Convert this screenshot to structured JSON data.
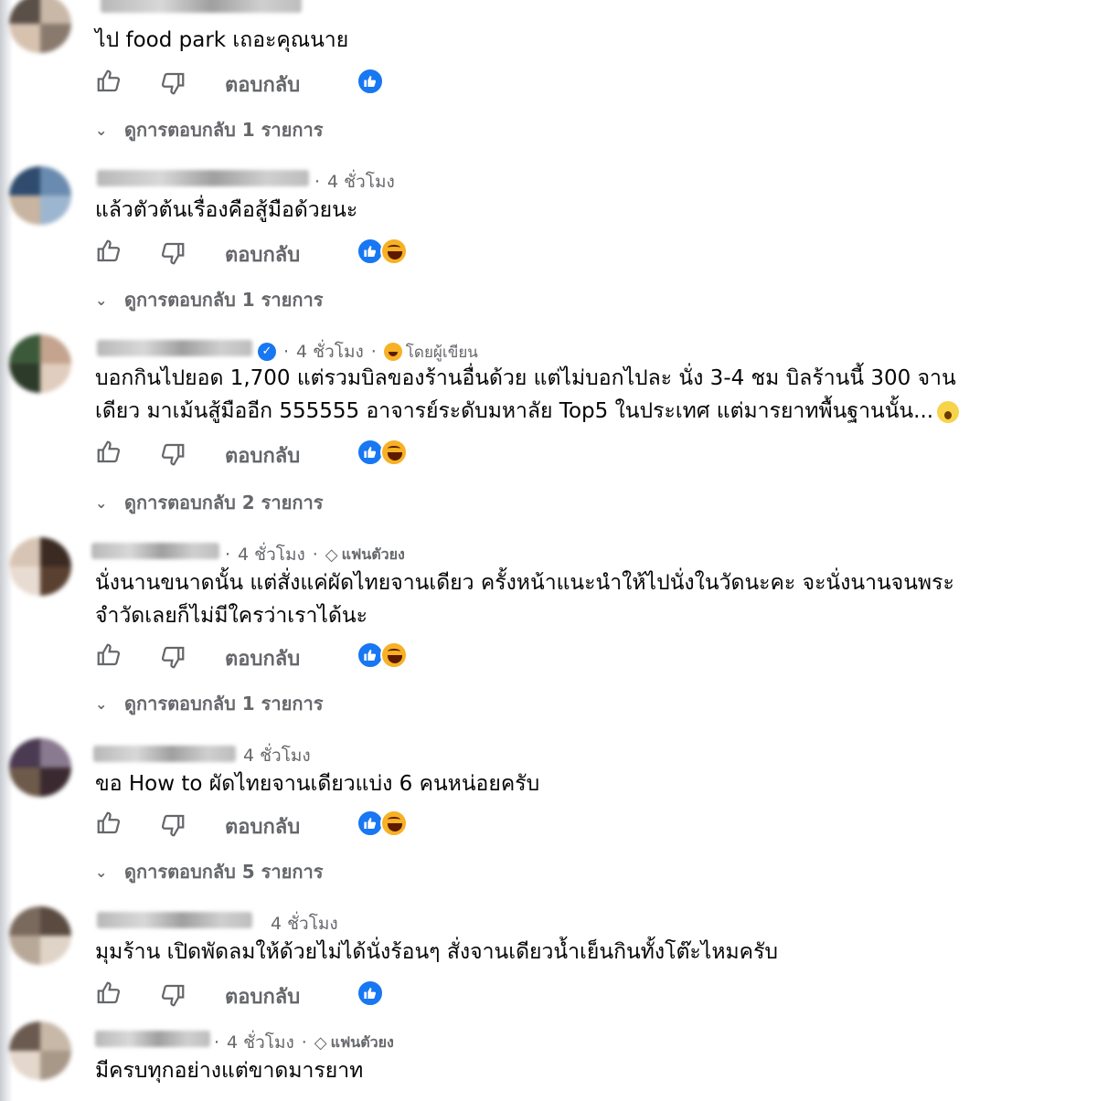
{
  "reply_label": "ตอบกลับ",
  "comments": [
    {
      "meta": "",
      "text_lines": [
        "ไป food park เถอะคุณนาย"
      ],
      "reactions": [
        "like"
      ],
      "view_replies": "ดูการตอบกลับ 1 รายการ"
    },
    {
      "meta": "4 ชั่วโมง",
      "text_lines": [
        "แล้วตัวต้นเรื่องคือสู้มือด้วยนะ"
      ],
      "reactions": [
        "like",
        "haha"
      ],
      "view_replies": "ดูการตอบกลับ 1 รายการ"
    },
    {
      "meta": "4 ชั่วโมง",
      "badge": "โดยผู้เขียน",
      "verified": true,
      "text_lines": [
        "บอกกินไปยอด 1,700 แต่รวมบิลของร้านอื่นด้วย แต่ไม่บอกไปละ นั่ง 3-4 ชม บิลร้านนี้ 300 จาน",
        "เดียว มาเม้นสู้มืออีก 555555 อาจารย์ระดับมหาลัย Top5 ในประเทศ แต่มารยาทพื้นฐานนั้น..."
      ],
      "reactions": [
        "like",
        "haha"
      ],
      "view_replies": "ดูการตอบกลับ 2 รายการ"
    },
    {
      "meta": "4 ชั่วโมง",
      "badge": "แฟนตัวยง",
      "text_lines": [
        "นั่งนานขนาดนั้น แต่สั่งแค่ผัดไทยจานเดียว ครั้งหน้าแนะนำให้ไปนั่งในวัดนะคะ จะนั่งนานจนพระ",
        "จำวัดเลยก็ไม่มีใครว่าเราได้นะ"
      ],
      "reactions": [
        "like",
        "haha"
      ],
      "view_replies": "ดูการตอบกลับ 1 รายการ"
    },
    {
      "meta": "4 ชั่วโมง",
      "text_lines": [
        "ขอ How to ผัดไทยจานเดียวแบ่ง 6 คนหน่อยครับ"
      ],
      "reactions": [
        "like",
        "haha"
      ],
      "view_replies": "ดูการตอบกลับ 5 รายการ"
    },
    {
      "meta": "4 ชั่วโมง",
      "text_lines": [
        "มุมร้าน เปิดพัดลมให้ด้วยไม่ได้นั่งร้อนๆ สั่งจานเดียวน้ำเย็นกินทั้งโต๊ะไหมครับ"
      ],
      "reactions": [
        "like"
      ],
      "view_replies": ""
    },
    {
      "meta": "4 ชั่วโมง",
      "badge": "แฟนตัวยง",
      "text_lines": [
        "มีครบทุกอย่างแต่ขาดมารยาท"
      ],
      "reactions": [],
      "view_replies": ""
    }
  ],
  "colors": {
    "like_blue": "#1877f2",
    "haha_yellow": "#f7b125",
    "secondary_text": "#65676b"
  },
  "icons": [
    "thumbs-up-icon",
    "thumbs-down-icon",
    "chevron-down-icon",
    "verified-icon",
    "diamond-icon"
  ]
}
